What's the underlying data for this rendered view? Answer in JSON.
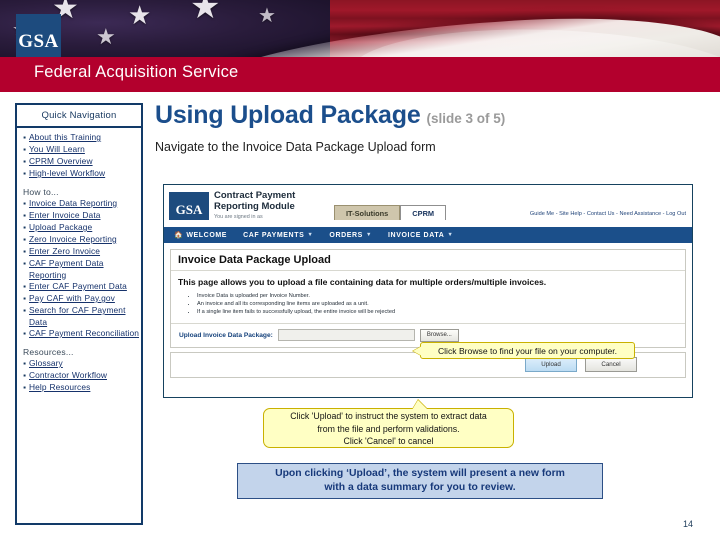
{
  "banner": {
    "logo_text": "GSA",
    "logo_icon": "gsa-logo-icon"
  },
  "header": {
    "title": "Federal Acquisition Service"
  },
  "sidebar": {
    "header": "Quick Navigation",
    "groups": [
      {
        "label": "",
        "items": [
          "About this Training",
          "You Will Learn",
          "CPRM Overview",
          "High-level Workflow"
        ]
      },
      {
        "label": "How to...",
        "items": [
          "Invoice Data Reporting",
          "Enter Invoice Data",
          "Upload Package",
          "Zero Invoice Reporting",
          "Enter Zero Invoice",
          "CAF Payment Data Reporting",
          "Enter CAF Payment Data",
          "Pay CAF with Pay.gov",
          "Search for CAF Payment Data",
          "CAF Payment Reconciliation"
        ]
      },
      {
        "label": "Resources...",
        "items": [
          "Glossary",
          "Contractor Workflow",
          "Help Resources"
        ]
      }
    ]
  },
  "main": {
    "title": "Using Upload Package",
    "slide_counter": "(slide 3 of 5)",
    "subtitle": "Navigate to the Invoice Data Package Upload form"
  },
  "appshot": {
    "logo_text": "GSA",
    "brand_line1": "Contract Payment",
    "brand_line2": "Reporting Module",
    "signed_in_as": "You are signed in as",
    "tabs": [
      {
        "label": "IT-Solutions",
        "active": false
      },
      {
        "label": "CPRM",
        "active": true
      }
    ],
    "util_links": "Guide Me - Site Help - Contact Us - Need Assistance - Log Out",
    "menu": [
      {
        "label": "WELCOME",
        "icon": "home-icon",
        "caret": false
      },
      {
        "label": "CAF PAYMENTS",
        "icon": "",
        "caret": true
      },
      {
        "label": "ORDERS",
        "icon": "",
        "caret": true
      },
      {
        "label": "INVOICE DATA",
        "icon": "",
        "caret": true
      }
    ],
    "panel": {
      "heading": "Invoice Data Package Upload",
      "lead": "This page allows you to upload a file containing data for multiple orders/multiple invoices.",
      "bullets": [
        "Invoice Data is uploaded per Invoice Number.",
        "An invoice and all its corresponding line items are uploaded as a unit.",
        "If a single line item fails to successfully upload, the entire invoice will be rejected"
      ],
      "upload_label": "Upload Invoice Data Package:",
      "file_value": "",
      "file_placeholder": "",
      "browse_button": "Browse...",
      "upload_button": "Upload",
      "cancel_button": "Cancel"
    }
  },
  "callouts": {
    "browse": "Click Browse to find your file on your computer.",
    "upload_line1": "Click 'Upload' to instruct the system to extract data",
    "upload_line2": "from the file and perform validations.",
    "upload_line3": "Click 'Cancel' to cancel",
    "result_line1": "Upon clicking ‘Upload’, the system will present a new form",
    "result_line2": "with a data summary for you to review."
  },
  "footer": {
    "page_number": "14"
  }
}
